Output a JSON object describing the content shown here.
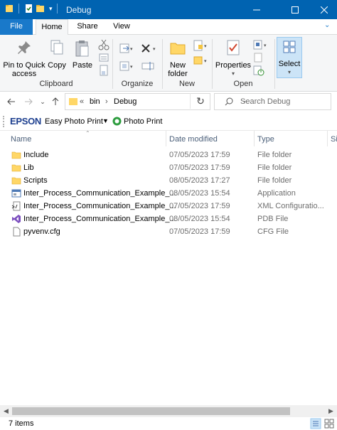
{
  "window": {
    "title": "Debug"
  },
  "tabs": {
    "file": "File",
    "home": "Home",
    "share": "Share",
    "view": "View"
  },
  "ribbon": {
    "pin_label": "Pin to Quick access",
    "copy_label": "Copy",
    "paste_label": "Paste",
    "clipboard_group": "Clipboard",
    "organize_group": "Organize",
    "new_folder_label": "New folder",
    "new_group": "New",
    "properties_label": "Properties",
    "open_group": "Open",
    "select_label": "Select"
  },
  "nav": {
    "crumb_overflow": "«",
    "crumbs": [
      "bin",
      "Debug"
    ],
    "search_placeholder": "Search Debug"
  },
  "extbar": {
    "brand": "EPSON",
    "easy_photo_print": "Easy Photo Print",
    "photo_print": "Photo Print"
  },
  "columns": {
    "name": "Name",
    "date": "Date modified",
    "type": "Type",
    "size": "Si"
  },
  "files": [
    {
      "name": "Include",
      "date": "07/05/2023 17:59",
      "type": "File folder",
      "icon": "folder-icon"
    },
    {
      "name": "Lib",
      "date": "07/05/2023 17:59",
      "type": "File folder",
      "icon": "folder-icon"
    },
    {
      "name": "Scripts",
      "date": "08/05/2023 17:27",
      "type": "File folder",
      "icon": "folder-icon"
    },
    {
      "name": "Inter_Process_Communication_Example_...",
      "date": "08/05/2023 15:54",
      "type": "Application",
      "icon": "application-icon"
    },
    {
      "name": "Inter_Process_Communication_Example_...",
      "date": "07/05/2023 17:59",
      "type": "XML Configuratio...",
      "icon": "xml-config-icon"
    },
    {
      "name": "Inter_Process_Communication_Example_...",
      "date": "08/05/2023 15:54",
      "type": "PDB File",
      "icon": "visual-studio-icon"
    },
    {
      "name": "pyvenv.cfg",
      "date": "07/05/2023 17:59",
      "type": "CFG File",
      "icon": "document-icon"
    }
  ],
  "status": {
    "item_count": "7 items"
  }
}
